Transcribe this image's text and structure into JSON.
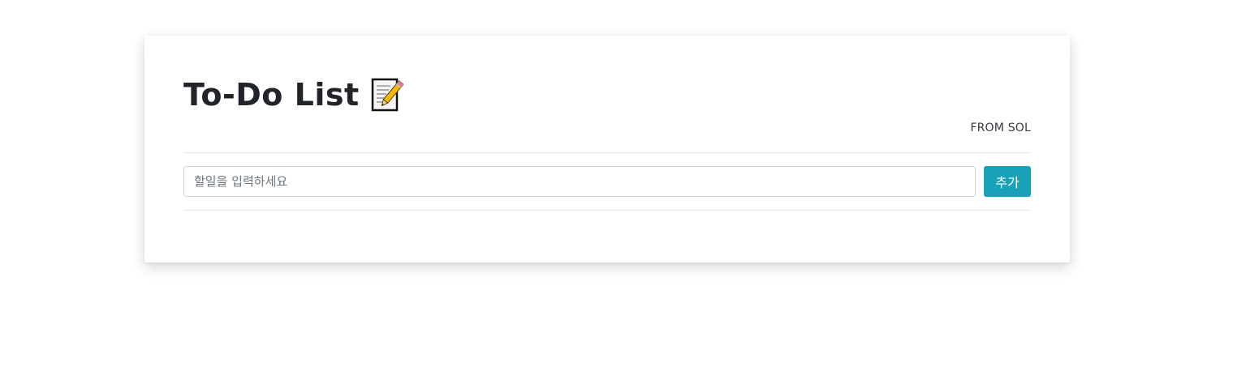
{
  "header": {
    "title": "To-Do List",
    "title_icon": "memo-icon",
    "author": "FROM SOL"
  },
  "form": {
    "input_placeholder": "할일을 입력하세요",
    "input_value": "",
    "add_button_label": "추가"
  },
  "colors": {
    "accent": "#17a2b8",
    "text": "#212529",
    "divider": "#e3e6e9"
  }
}
